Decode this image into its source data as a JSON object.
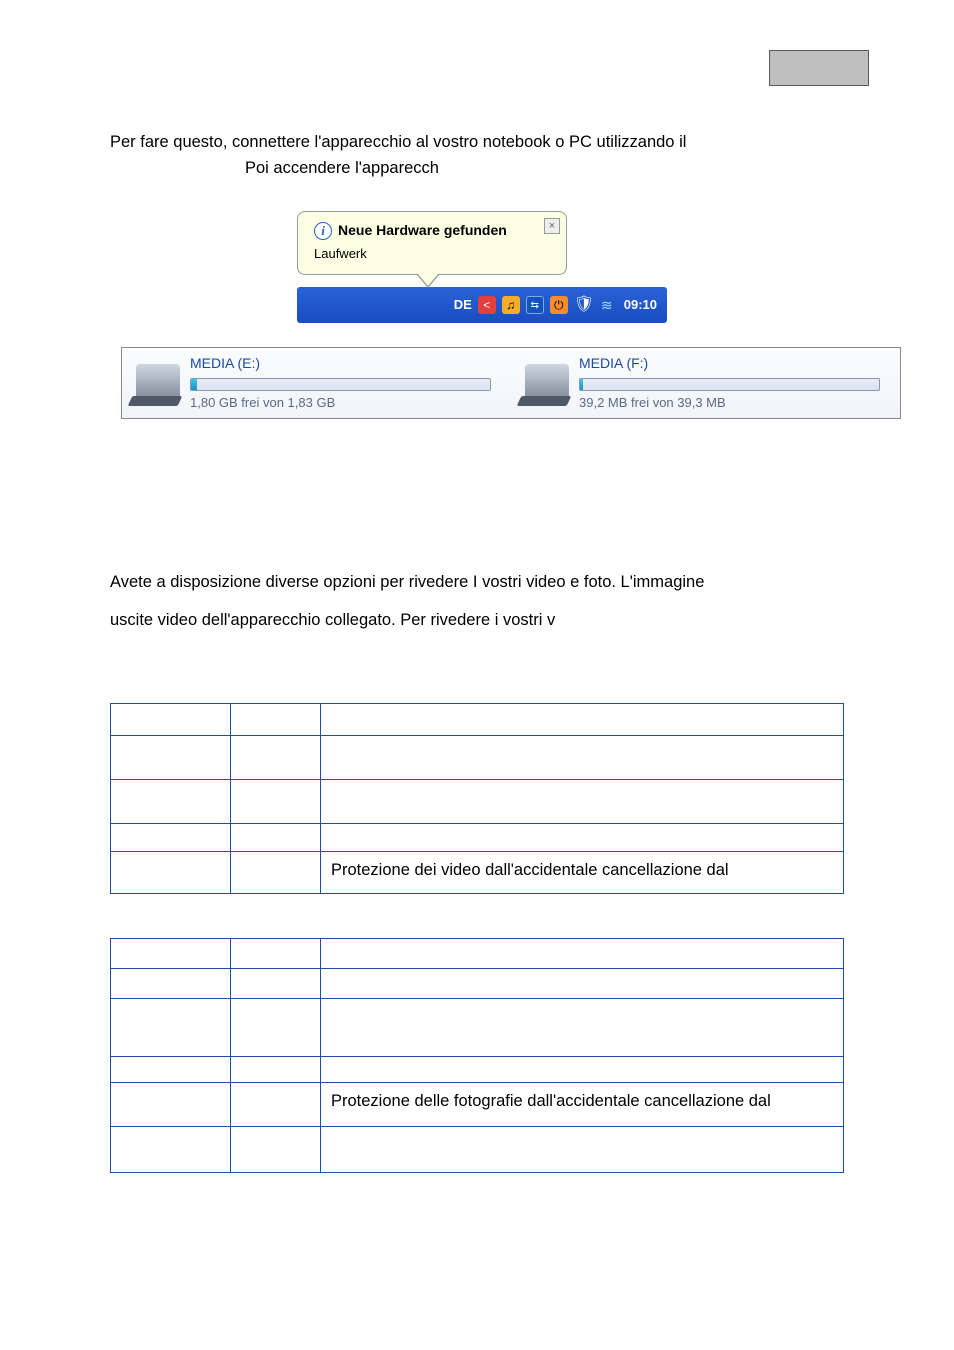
{
  "header": {
    "page_number": ""
  },
  "intro": {
    "line1": "Per fare questo, connettere l'apparecchio al vostro notebook o PC utilizzando il",
    "line2": "Poi accendere l'apparecch"
  },
  "balloon": {
    "title": "Neue Hardware gefunden",
    "subtitle": "Laufwerk",
    "close": "×"
  },
  "taskbar": {
    "lang": "DE",
    "time": "09:10"
  },
  "drives": {
    "e": {
      "name": "MEDIA (E:)",
      "free": "1,80 GB frei von 1,83 GB",
      "fill_pct": 2
    },
    "f": {
      "name": "MEDIA (F:)",
      "free": "39,2 MB frei von 39,3 MB",
      "fill_pct": 1
    }
  },
  "playback": {
    "line1": "Avete a disposizione diverse opzioni per rivedere I vostri video e foto. L'immagine",
    "line2": "uscite video dell'apparecchio collegato. Per rivedere i vostri v"
  },
  "table1": {
    "rows": [
      [
        "",
        "",
        ""
      ],
      [
        "",
        "",
        ""
      ],
      [
        "",
        "",
        ""
      ],
      [
        "",
        "",
        ""
      ],
      [
        "",
        "",
        "Protezione dei video dall'accidentale cancellazione dal"
      ]
    ]
  },
  "table2": {
    "rows": [
      [
        "",
        "",
        ""
      ],
      [
        "",
        "",
        ""
      ],
      [
        "",
        "",
        ""
      ],
      [
        "",
        "",
        ""
      ],
      [
        "",
        "",
        "Protezione delle fotografie dall'accidentale cancellazione dal"
      ],
      [
        "",
        "",
        ""
      ]
    ]
  }
}
